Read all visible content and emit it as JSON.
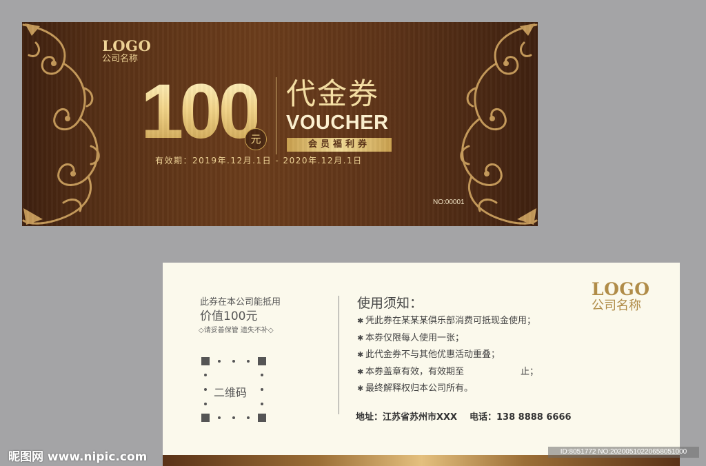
{
  "front": {
    "logo": "LOGO",
    "company": "公司名称",
    "amount": "100",
    "unit": "元",
    "title_cn": "代金券",
    "title_en": "VOUCHER",
    "member": "会员福利券",
    "validity": "有效期：2019年.12月.1日 - 2020年.12月.1日",
    "serial": "NO:00001"
  },
  "back": {
    "value_line1": "此券在本公司能抵用",
    "value_line2": "价值100元",
    "keep_note": "◇请妥善保管 遗失不补◇",
    "qr_label": "二维码",
    "notice_title": "使用须知：",
    "notices": [
      "凭此券在某某某俱乐部消费可抵现金使用；",
      "本券仅限每人使用一张；",
      "此代金券不与其他优惠活动重叠；",
      "本券盖章有效，有效期至",
      "最终解释权归本公司所有。"
    ],
    "notice4_end": "止；",
    "address": "地址：江苏省苏州市XXX",
    "phone": "电话：138 8888 6666",
    "logo": "LOGO",
    "company": "公司名称"
  },
  "watermark": {
    "site": "昵图网 www.nipic.com",
    "id": "ID:8051772 NO:20200510220658051000"
  },
  "colors": {
    "front_bg": "#5a3217",
    "gold": "#f3d58a",
    "back_bg": "#fbf9ec",
    "page_bg": "#a4a4a6"
  }
}
